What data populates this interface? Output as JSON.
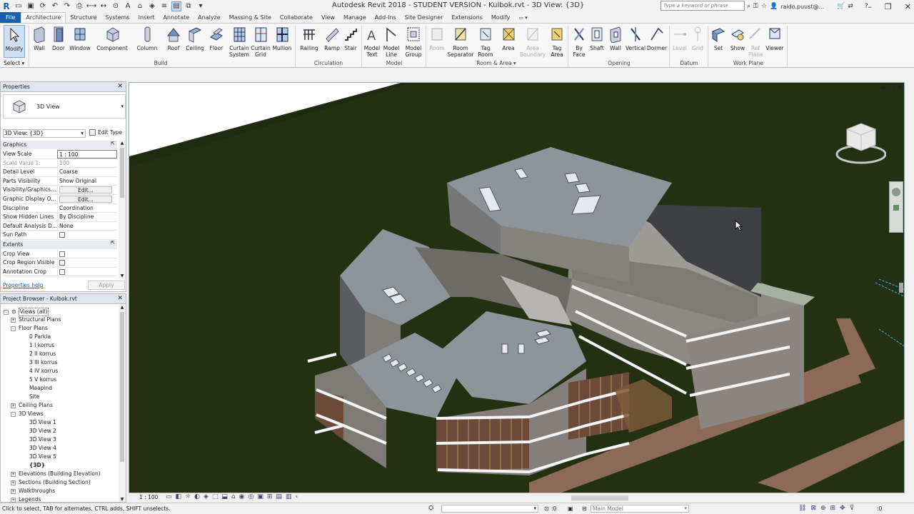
{
  "app": {
    "title": "Autodesk Revit 2018 - STUDENT VERSION -    Kulbok.rvt - 3D View: {3D}",
    "search_placeholder": "Type a keyword or phrase",
    "user": "raido.puust@..."
  },
  "tabs": [
    "File",
    "Architecture",
    "Structure",
    "Systems",
    "Insert",
    "Annotate",
    "Analyze",
    "Massing & Site",
    "Collaborate",
    "View",
    "Manage",
    "Add-Ins",
    "Site Designer",
    "Extensions",
    "Modify"
  ],
  "active_tab": "Architecture",
  "ribbon": {
    "modify": {
      "label": "Modify",
      "select": "Select"
    },
    "build": {
      "label": "Build",
      "buttons": [
        "Wall",
        "Door",
        "Window",
        "Component",
        "Column",
        "Roof",
        "Ceiling",
        "Floor",
        "Curtain System",
        "Curtain Grid",
        "Mullion"
      ]
    },
    "circulation": {
      "label": "Circulation",
      "buttons": [
        "Railing",
        "Ramp",
        "Stair"
      ]
    },
    "model": {
      "label": "Model",
      "buttons": [
        "Model Text",
        "Model Line",
        "Model Group"
      ]
    },
    "room_area": {
      "label": "Room & Area",
      "buttons": [
        "Room",
        "Room Separator",
        "Tag Room",
        "Area",
        "Area Boundary",
        "Tag Area"
      ]
    },
    "opening": {
      "label": "Opening",
      "buttons": [
        "By Face",
        "Shaft",
        "Wall",
        "Vertical",
        "Dormer"
      ]
    },
    "datum": {
      "label": "Datum",
      "buttons": [
        "Level",
        "Grid"
      ]
    },
    "work_plane": {
      "label": "Work Plane",
      "buttons": [
        "Set",
        "Show",
        "Ref Plane",
        "Viewer"
      ]
    }
  },
  "properties": {
    "title": "Properties",
    "type_name": "3D View",
    "instance": "3D View: {3D}",
    "edit_type": "Edit Type",
    "categories": {
      "graphics": "Graphics",
      "extents": "Extents"
    },
    "rows": [
      {
        "k": "View Scale",
        "v": "1 : 100"
      },
      {
        "k": "Scale Value    1:",
        "v": "100"
      },
      {
        "k": "Detail Level",
        "v": "Coarse"
      },
      {
        "k": "Parts Visibility",
        "v": "Show Original"
      },
      {
        "k": "Visibility/Graphics...",
        "v": "Edit..."
      },
      {
        "k": "Graphic Display O...",
        "v": "Edit..."
      },
      {
        "k": "Discipline",
        "v": "Coordination"
      },
      {
        "k": "Show Hidden Lines",
        "v": "By Discipline"
      },
      {
        "k": "Default Analysis D...",
        "v": "None"
      },
      {
        "k": "Sun Path",
        "v": ""
      }
    ],
    "extent_rows": [
      "Crop View",
      "Crop Region Visible",
      "Annotation Crop"
    ],
    "help": "Properties help",
    "apply": "Apply"
  },
  "browser": {
    "title": "Project Browser - Kulbok.rvt",
    "root": "Views (all)",
    "items": [
      {
        "t": "Structural Plans",
        "lvl": 1,
        "tog": "+"
      },
      {
        "t": "Floor Plans",
        "lvl": 1,
        "tog": "-"
      },
      {
        "t": "0 Parkla",
        "lvl": 2
      },
      {
        "t": "1 I korrus",
        "lvl": 2
      },
      {
        "t": "2 II korrus",
        "lvl": 2
      },
      {
        "t": "3 III korrus",
        "lvl": 2
      },
      {
        "t": "4 IV korrus",
        "lvl": 2
      },
      {
        "t": "5 V korrus",
        "lvl": 2
      },
      {
        "t": "Maapind",
        "lvl": 2
      },
      {
        "t": "Site",
        "lvl": 2
      },
      {
        "t": "Ceiling Plans",
        "lvl": 1,
        "tog": "+"
      },
      {
        "t": "3D Views",
        "lvl": 1,
        "tog": "-"
      },
      {
        "t": "3D View 1",
        "lvl": 2
      },
      {
        "t": "3D View 2",
        "lvl": 2
      },
      {
        "t": "3D View 3",
        "lvl": 2
      },
      {
        "t": "3D View 4",
        "lvl": 2
      },
      {
        "t": "3D View 5",
        "lvl": 2
      },
      {
        "t": "{3D}",
        "lvl": 2,
        "bold": true
      },
      {
        "t": "Elevations (Building Elevation)",
        "lvl": 1,
        "tog": "+"
      },
      {
        "t": "Sections (Building Section)",
        "lvl": 1,
        "tog": "+"
      },
      {
        "t": "Walkthroughs",
        "lvl": 1,
        "tog": "+"
      },
      {
        "t": "Legends",
        "lvl": 1,
        "tog": "+"
      }
    ]
  },
  "viewcontrol": {
    "scale": "1 : 100"
  },
  "status": {
    "message": "Click to select, TAB for alternates, CTRL adds, SHIFT unselects.",
    "count": ":0",
    "model": "Main Model",
    "filter": ":0"
  },
  "colors": {
    "file_tab": "#1b5faa",
    "grass": "#243012",
    "path": "#8b6a58",
    "roof": "#8d949a"
  }
}
